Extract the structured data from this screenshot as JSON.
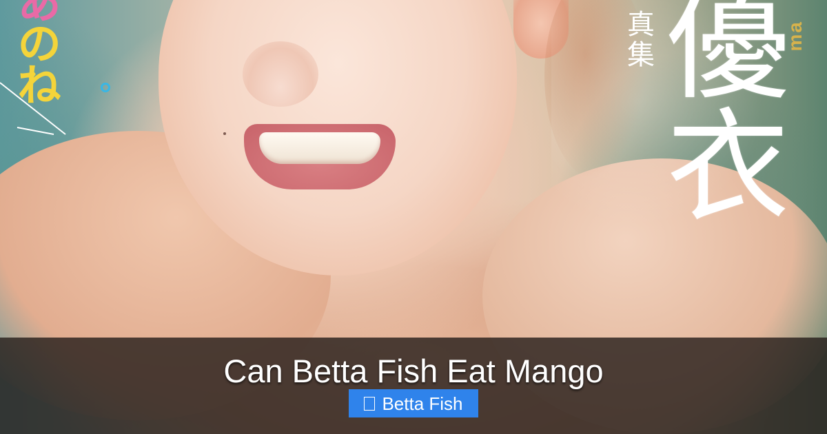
{
  "hero_image": {
    "subject": "smiling woman on magazine cover",
    "cover_text": {
      "kana": [
        "あ",
        "の",
        "ね"
      ],
      "series": "真集",
      "name": "優衣",
      "roman": "ma"
    }
  },
  "post": {
    "title": "Can Betta Fish Eat Mango",
    "category": "Betta Fish",
    "category_icon": "folder-icon"
  },
  "colors": {
    "caption_bg": "#28201c",
    "badge_bg": "#2f83eb",
    "title_text": "#ffffff"
  }
}
